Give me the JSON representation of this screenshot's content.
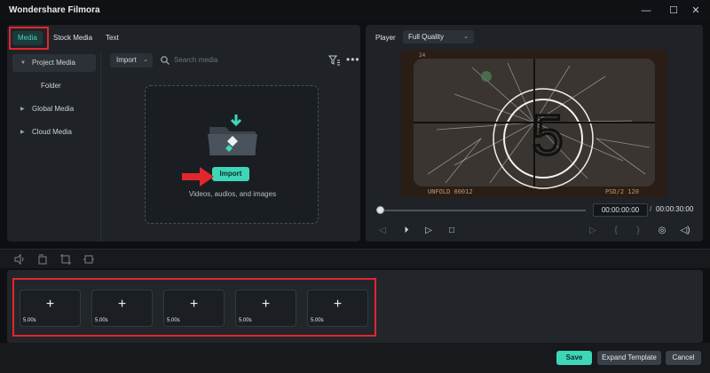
{
  "window": {
    "title": "Wondershare Filmora",
    "minimize_glyph": "—",
    "maximize_glyph": "☐",
    "close_glyph": "✕"
  },
  "tabs": [
    {
      "label": "Media",
      "active": true
    },
    {
      "label": "Stock Media",
      "active": false
    },
    {
      "label": "Text",
      "active": false
    }
  ],
  "sidebar": {
    "items": [
      {
        "label": "Project Media",
        "selected": true,
        "expander": "▼"
      },
      {
        "label": "Folder",
        "selected": false,
        "expander": ""
      },
      {
        "label": "Global Media",
        "selected": false,
        "expander": "▶"
      },
      {
        "label": "Cloud Media",
        "selected": false,
        "expander": "▶"
      }
    ],
    "collapse_glyph": "‹"
  },
  "media_toolbar": {
    "import_label": "Import",
    "import_chevron": "⌄",
    "search_placeholder": "Search media",
    "more_glyph": "•••"
  },
  "dropzone": {
    "import_button": "Import",
    "hint": "Videos, audios, and images"
  },
  "player": {
    "label": "Player",
    "quality": "Full Quality",
    "quality_chevron": "⌄",
    "countdown_number": "5",
    "film_left_text": "UNFOLD 00012",
    "film_right_text": "PSD/2 120",
    "film_top_text": "24",
    "current_time": "00:00:00:00",
    "time_separator": "/",
    "total_time": "00:00:30:00",
    "controls": {
      "prev_frame": "◁",
      "play_back": "⏵",
      "play": "▷",
      "stop": "□",
      "render": "▷",
      "mark_in": "{",
      "mark_out": "}",
      "snapshot": "◎",
      "volume": "◁)"
    }
  },
  "slots": [
    {
      "duration": "5.00s",
      "plus": "+"
    },
    {
      "duration": "5.00s",
      "plus": "+"
    },
    {
      "duration": "5.00s",
      "plus": "+"
    },
    {
      "duration": "5.00s",
      "plus": "+"
    },
    {
      "duration": "5.00s",
      "plus": "+"
    }
  ],
  "footer": {
    "save": "Save",
    "expand": "Expand Template",
    "cancel": "Cancel"
  },
  "colors": {
    "accent": "#3fd6b8",
    "highlight_box": "#e3262c",
    "panel_bg": "#1f2328",
    "window_bg": "#0d0f12"
  }
}
